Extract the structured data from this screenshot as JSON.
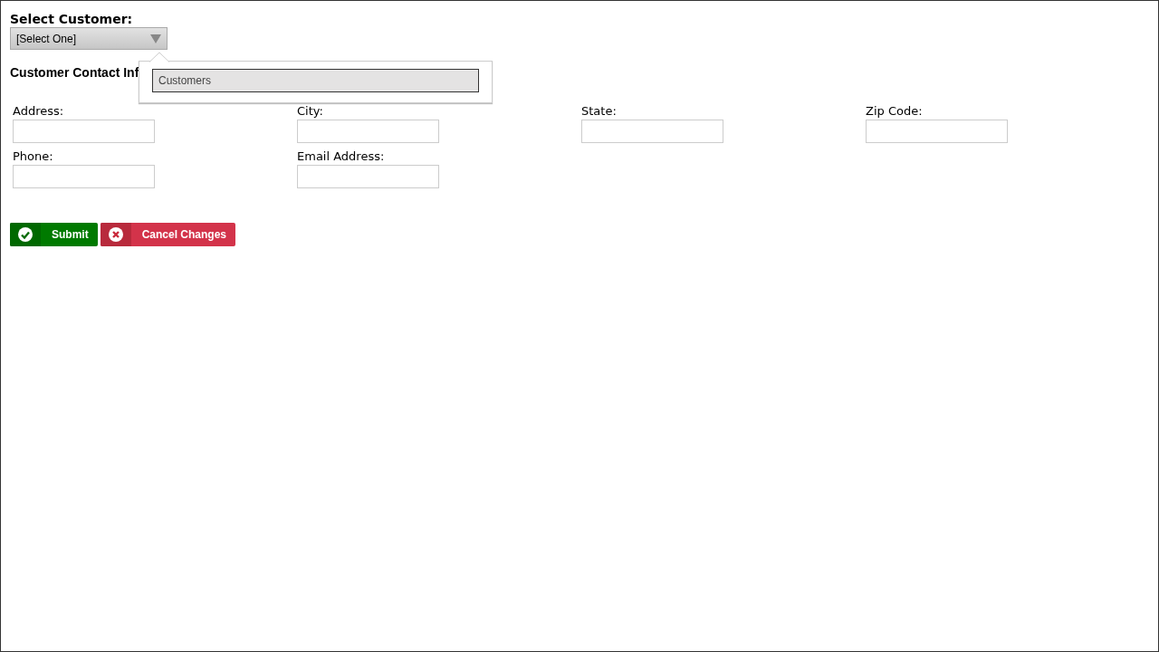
{
  "customer_select": {
    "label": "Select Customer:",
    "value": "[Select One]",
    "expanded": true,
    "options": [
      {
        "label": "Customers",
        "selected": true
      }
    ]
  },
  "contact_heading": "Customer Contact Inf",
  "fields": [
    {
      "label": "Address:"
    },
    {
      "label": "City:"
    },
    {
      "label": "State:"
    },
    {
      "label": "Zip Code:"
    },
    {
      "label": "Phone:"
    },
    {
      "label": "Email Address:"
    }
  ],
  "buttons": [
    {
      "label": "Submit",
      "kind": "submit"
    },
    {
      "label": "Cancel Changes",
      "kind": "cancel"
    }
  ]
}
